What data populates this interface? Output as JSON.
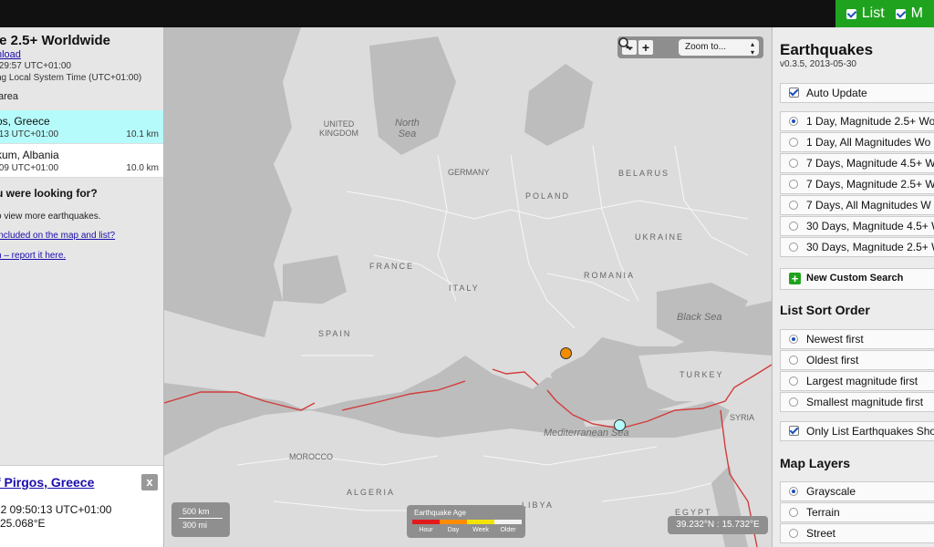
{
  "topbar": {
    "toggles": [
      {
        "label": "List",
        "icon": "checkbox-checked-icon"
      },
      {
        "label": "M",
        "icon": "checkbox-checked-icon"
      }
    ]
  },
  "left": {
    "title": "le 2.5+ Worldwide",
    "download": "nload",
    "updated": ":29:57 UTC+01:00",
    "localtime": "ng Local System Time (UTC+01:00)",
    "area": "area",
    "items": [
      {
        "place": "os, Greece",
        "time": ":13 UTC+01:00",
        "depth": "10.1 km"
      },
      {
        "place": "kum, Albania",
        "time": ":09 UTC+01:00",
        "depth": "10.0 km"
      }
    ],
    "question": "u were looking for?",
    "zoom_hint": "o view more earthquakes.",
    "link_included": "included on the map and list?",
    "link_report": "n – report it here."
  },
  "popup": {
    "title": "f Pirgos, Greece",
    "close": "x",
    "time": "22 09:50:13 UTC+01:00",
    "coord": "l 25.068°E"
  },
  "map": {
    "zoom_out": "−",
    "zoom_in": "+",
    "zoom_select": "Zoom to...",
    "scale": [
      "500 km",
      "300 mi"
    ],
    "legend_title": "Earthquake Age",
    "legend": [
      {
        "label": "Hour",
        "color": "#e31a1c"
      },
      {
        "label": "Day",
        "color": "#ff8c00"
      },
      {
        "label": "Week",
        "color": "#f2e400"
      },
      {
        "label": "Older",
        "color": "#f2f2f2"
      }
    ],
    "coords": "39.232°N : 15.732°E",
    "labels": {
      "uk": "UNITED\nKINGDOM",
      "north_sea": "North\nSea",
      "germany": "GERMANY",
      "belarus": "BELARUS",
      "poland": "POLAND",
      "ukraine": "UKRAINE",
      "france": "FRANCE",
      "romania": "ROMANIA",
      "italy": "ITALY",
      "black_sea": "Black Sea",
      "spain": "SPAIN",
      "turkey": "TURKEY",
      "med_sea": "Mediterranean Sea",
      "syria": "SYRIA",
      "morocco": "MOROCCO",
      "algeria": "ALGERIA",
      "libya": "LIBYA",
      "egypt": "EGYPT"
    },
    "quakes": [
      {
        "color": "#f28c00"
      },
      {
        "color": "#b6fbfb"
      }
    ]
  },
  "right": {
    "title": "Earthquakes",
    "version": "v0.3.5, 2013-05-30",
    "auto_update": "Auto Update",
    "feeds": [
      {
        "label": "1 Day, Magnitude 2.5+ Wo",
        "selected": true
      },
      {
        "label": "1 Day, All Magnitudes Wo",
        "selected": false
      },
      {
        "label": "7 Days, Magnitude 4.5+ W",
        "selected": false
      },
      {
        "label": "7 Days, Magnitude 2.5+ W",
        "selected": false
      },
      {
        "label": "7 Days, All Magnitudes W",
        "selected": false
      },
      {
        "label": "30 Days, Magnitude 4.5+ W",
        "selected": false
      },
      {
        "label": "30 Days, Magnitude 2.5+ W",
        "selected": false
      }
    ],
    "custom_search": "New Custom Search",
    "sort_title": "List Sort Order",
    "sort": [
      {
        "label": "Newest first",
        "selected": true
      },
      {
        "label": "Oldest first",
        "selected": false
      },
      {
        "label": "Largest magnitude first",
        "selected": false
      },
      {
        "label": "Smallest magnitude first",
        "selected": false
      }
    ],
    "only_list": "Only List Earthquakes Sho",
    "layers_title": "Map Layers",
    "layers": [
      {
        "label": "Grayscale",
        "selected": true
      },
      {
        "label": "Terrain",
        "selected": false
      },
      {
        "label": "Street",
        "selected": false
      }
    ]
  }
}
